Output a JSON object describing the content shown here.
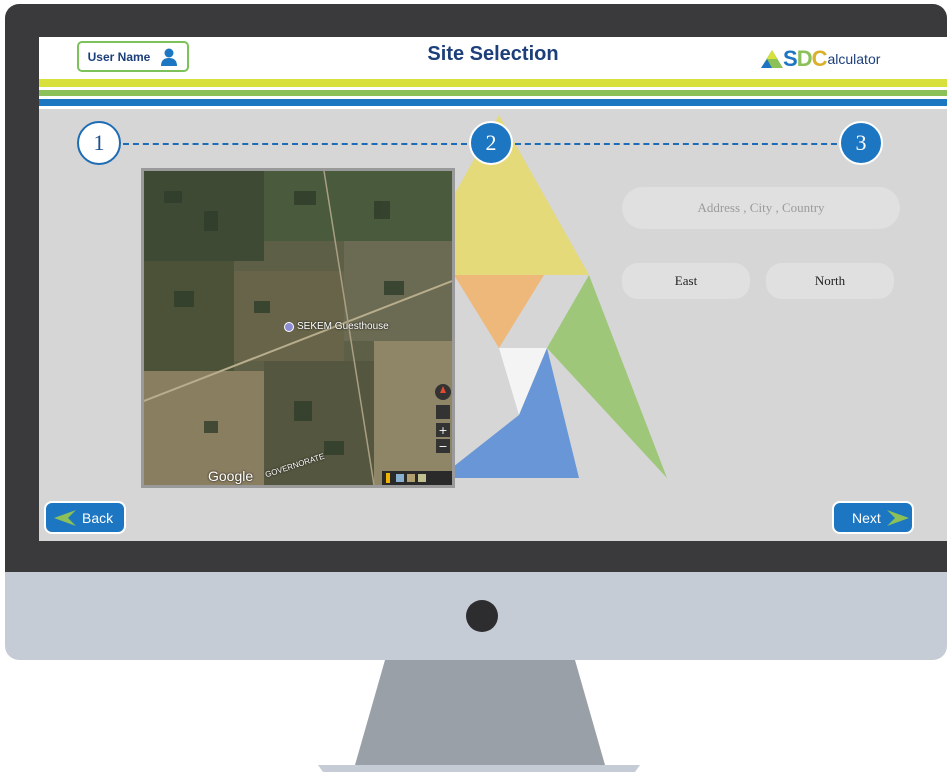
{
  "header": {
    "user_label": "User Name",
    "title": "Site Selection",
    "logo": {
      "a": "A",
      "s": "S",
      "d": "D",
      "c": "C",
      "rest": "alculator"
    }
  },
  "steps": [
    "1",
    "2",
    "3"
  ],
  "map": {
    "place_label": "SEKEM Guesthouse",
    "provider": "Google",
    "region_label": "GOVERNORATE"
  },
  "form": {
    "address_placeholder": "Address , City , Country",
    "east_label": "East",
    "north_label": "North"
  },
  "nav": {
    "back_label": "Back",
    "next_label": "Next"
  },
  "icons": [
    "user-icon",
    "map-pin-icon",
    "compass-icon",
    "zoom-in-icon",
    "zoom-out-icon",
    "pegman-icon",
    "back-arrow-icon",
    "next-arrow-icon"
  ],
  "colors": {
    "brand_blue": "#1d76c1",
    "title_navy": "#1c3f7a",
    "accent_green": "#8cc159",
    "accent_yellow": "#d8e03c",
    "logo_green": "#7cc15a"
  }
}
